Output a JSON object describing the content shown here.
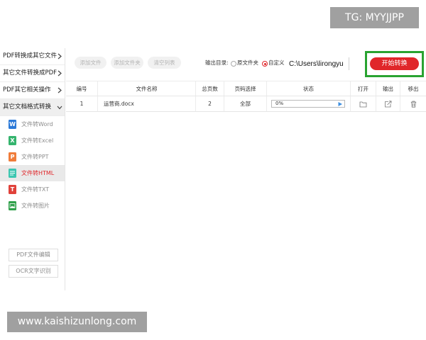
{
  "watermarks": {
    "top_text": "TG: MYYJJPP",
    "bottom_text": "www.kaishizunlong.com"
  },
  "colors": {
    "accent": "#e0262a",
    "highlight_box": "#29a331",
    "progress_icon": "#3d8fe0",
    "watermark_bg": "#a0a0a0"
  },
  "sidebar": {
    "categories": [
      {
        "label": "PDF转换成其它文件",
        "icon": "chevron-right-icon",
        "expanded": false
      },
      {
        "label": "其它文件转换成PDF",
        "icon": "chevron-right-icon",
        "expanded": false
      },
      {
        "label": "PDF其它相关操作",
        "icon": "chevron-right-icon",
        "expanded": false
      },
      {
        "label": "其它文档格式转换",
        "icon": "chevron-down-icon",
        "expanded": true
      }
    ],
    "items": [
      {
        "label": "文件转Word",
        "icon": "word-icon",
        "badge": "W",
        "color": "#2b79d8",
        "selected": false
      },
      {
        "label": "文件转Excel",
        "icon": "excel-icon",
        "badge": "X",
        "color": "#35b46e",
        "selected": false
      },
      {
        "label": "文件转PPT",
        "icon": "ppt-icon",
        "badge": "P",
        "color": "#f07c3a",
        "selected": false
      },
      {
        "label": "文件转HTML",
        "icon": "html-icon",
        "color": "#3cc6b0",
        "selected": true
      },
      {
        "label": "文件转TXT",
        "icon": "txt-icon",
        "badge": "T",
        "color": "#e0413a",
        "selected": false
      },
      {
        "label": "文件转图片",
        "icon": "image-icon",
        "color": "#2fa04a",
        "selected": false
      }
    ],
    "tools": [
      {
        "label": "PDF文件编辑"
      },
      {
        "label": "OCR文字识别"
      }
    ]
  },
  "toolbar": {
    "add_file": "添加文件",
    "add_folder": "添加文件夹",
    "clear_list": "清空列表",
    "output_label": "输出目录:",
    "output_options": [
      {
        "label": "原文件夹",
        "checked": false
      },
      {
        "label": "自定义",
        "checked": true
      }
    ],
    "output_path": "C:\\Users\\lirongyu",
    "start_button": "开始转换"
  },
  "table": {
    "headers": [
      "编号",
      "文件名称",
      "总页数",
      "页码选择",
      "状态",
      "打开",
      "输出",
      "移出"
    ],
    "rows": [
      {
        "index": "1",
        "file_name": "运营商.docx",
        "total_pages": "2",
        "page_range": "全部",
        "status": "0%",
        "progress": 0,
        "open_icon": "folder-icon",
        "output_icon": "export-icon",
        "remove_icon": "trash-icon"
      }
    ]
  }
}
